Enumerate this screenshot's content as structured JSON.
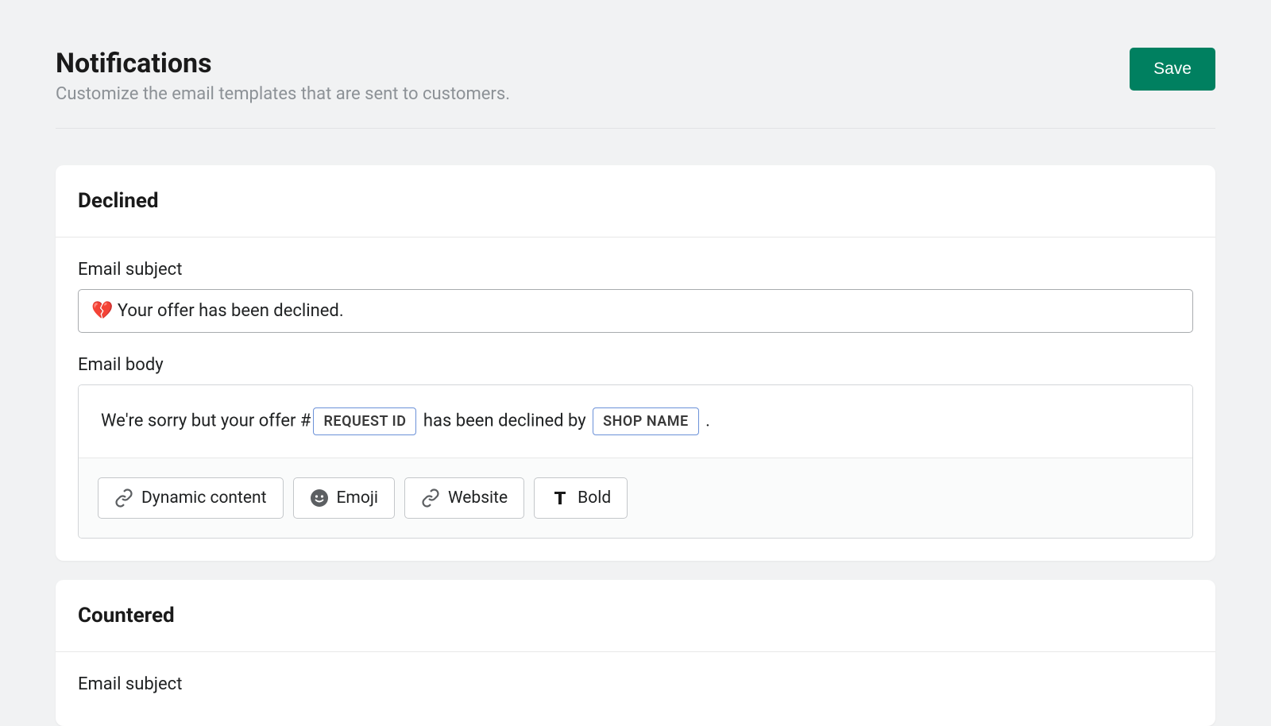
{
  "header": {
    "title": "Notifications",
    "subtitle": "Customize the email templates that are sent to customers.",
    "save_label": "Save"
  },
  "templates": [
    {
      "name": "Declined",
      "subject_label": "Email subject",
      "subject_value": "💔 Your offer has been declined.",
      "body_label": "Email body",
      "body": {
        "pre_text": "We're sorry but your offer #",
        "token1": "REQUEST ID",
        "mid_text": " has been declined by ",
        "token2": "SHOP NAME",
        "post_text": " ."
      }
    },
    {
      "name": "Countered",
      "subject_label": "Email subject"
    }
  ],
  "toolbar": {
    "dynamic_label": "Dynamic content",
    "emoji_label": "Emoji",
    "website_label": "Website",
    "bold_label": "Bold"
  }
}
